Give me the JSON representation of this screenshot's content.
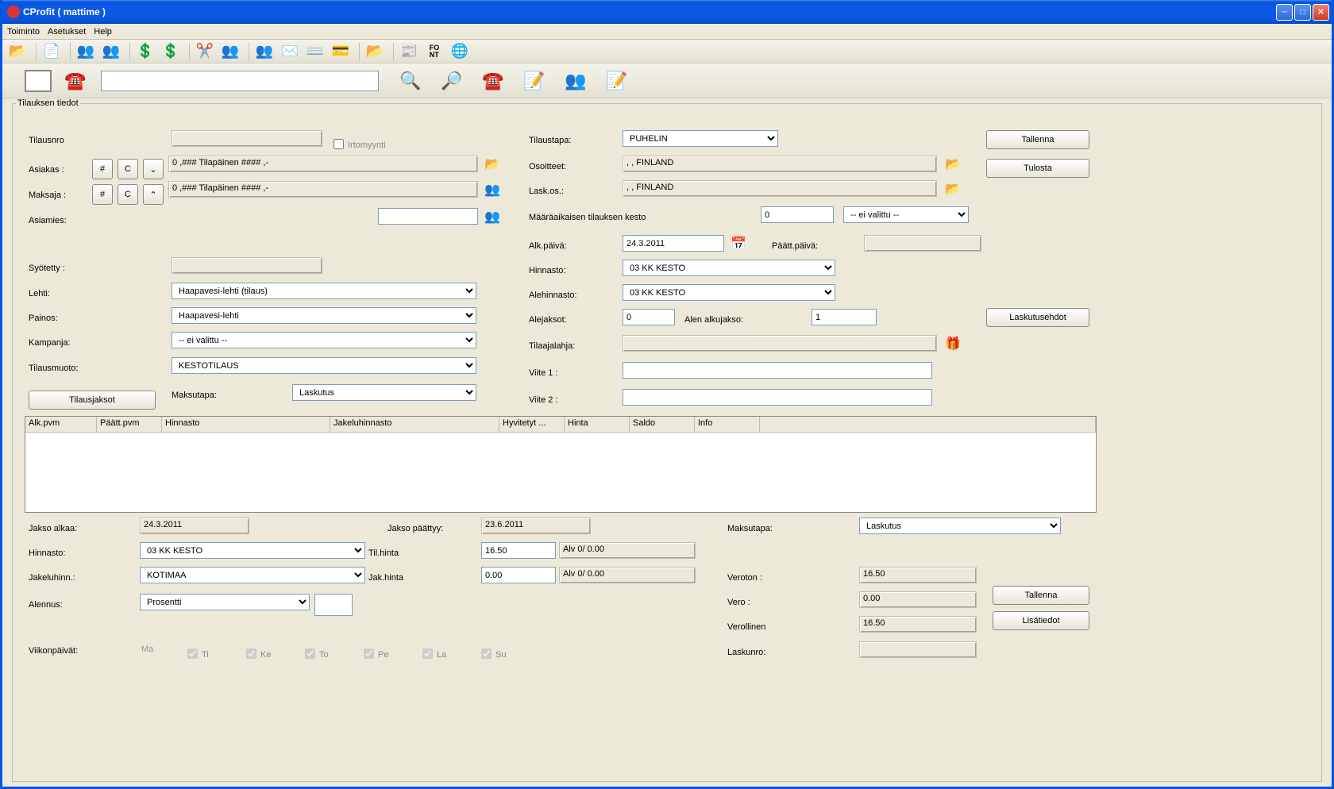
{
  "window": {
    "title": "CProfit ( mattime )"
  },
  "menubar": [
    "Toiminto",
    "Asetukset",
    "Help"
  ],
  "fieldset_legend": "Tilauksen tiedot",
  "buttons": {
    "tallenna": "Tallenna",
    "tulosta": "Tulosta",
    "laskutusehdot": "Laskutusehdot",
    "tilausjaksot": "Tilausjaksot",
    "tallenna2": "Tallenna",
    "lisatiedot": "Lisätiedot",
    "hash": "#",
    "C": "C",
    "caret_down": "⌄",
    "caret_up": "⌃"
  },
  "labels": {
    "tilausnro": "Tilausnro",
    "irtomyynti": "Irtomyynti",
    "asiakas": "Asiakas :",
    "maksaja": "Maksaja :",
    "asiamies": "Asiamies:",
    "syotetty": "Syötetty :",
    "lehti": "Lehti:",
    "painos": "Painos:",
    "kampanja": "Kampanja:",
    "tilausmuoto": "Tilausmuoto:",
    "maksutapa": "Maksutapa:",
    "tilaustapa": "Tilaustapa:",
    "osoitteet": "Osoitteet:",
    "laskos": "Lask.os.:",
    "maaraaika": "Määräaikaisen tilauksen kesto",
    "alkpaiva": "Alk.päivä:",
    "paattpaiva": "Päätt.päivä:",
    "hinnasto": "Hinnasto:",
    "alehinnasto": "Alehinnasto:",
    "alejaksot": "Alejaksot:",
    "alen_alkujakso": "Alen alkujakso:",
    "tilaajalahja": "Tilaajalahja:",
    "viite1": "Viite 1 :",
    "viite2": "Viite 2 :",
    "jakso_alkaa": "Jakso alkaa:",
    "jakso_paattyy": "Jakso päättyy:",
    "hinnasto2": "Hinnasto:",
    "tilhinta": "Til.hinta",
    "jakeluhinn": "Jakeluhinn.:",
    "jakhinta": "Jak.hinta",
    "alennus": "Alennus:",
    "maksutapa2": "Maksutapa:",
    "veroton": "Veroton :",
    "vero": "Vero :",
    "verollinen": "Verollinen",
    "laskunro": "Laskunro:",
    "viikonpaivat": "Viikonpäivät:"
  },
  "values": {
    "asiakas": "0 ,### Tilapäinen #### ,-",
    "maksaja": "0 ,### Tilapäinen #### ,-",
    "tilaustapa": "PUHELIN",
    "osoitteet": ", , FINLAND",
    "laskos": ", , FINLAND",
    "maaraaika_kesto": "0",
    "ei_valittu": "-- ei valittu --",
    "alkpaiva": "24.3.2011",
    "hinnasto": "03 KK KESTO",
    "alehinnasto": "03 KK KESTO",
    "alejaksot": "0",
    "alen_alkujakso": "1",
    "lehti": "Haapavesi-lehti (tilaus)",
    "painos": "Haapavesi-lehti",
    "kampanja": "-- ei valittu --",
    "tilausmuoto": "KESTOTILAUS",
    "maksutapa": "Laskutus",
    "jakso_alkaa": "24.3.2011",
    "jakso_paattyy": "23.6.2011",
    "hinnasto2": "03 KK KESTO",
    "jakeluhinn": "KOTIMAA",
    "alennus": "Prosentti",
    "tilhinta": "16.50",
    "tilhinta_alv": "Alv 0/ 0.00",
    "jakhinta": "0.00",
    "jakhinta_alv": "Alv 0/ 0.00",
    "maksutapa2": "Laskutus",
    "veroton": "16.50",
    "vero": "0.00",
    "verollinen": "16.50"
  },
  "table_headers": [
    "Alk.pvm",
    "Päätt.pvm",
    "Hinnasto",
    "Jakeluhinnasto",
    "Hyvitetyt ...",
    "Hinta",
    "Saldo",
    "Info"
  ],
  "weekdays": [
    "Ma",
    "Ti",
    "Ke",
    "To",
    "Pe",
    "La",
    "Su"
  ]
}
